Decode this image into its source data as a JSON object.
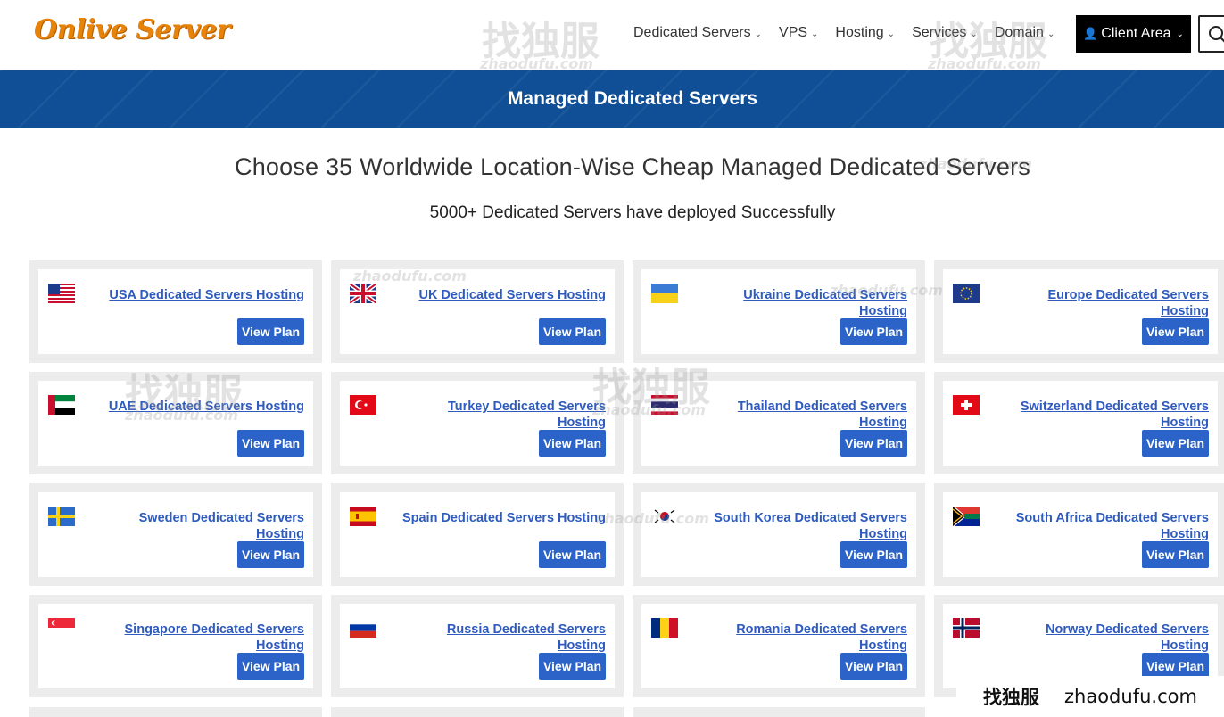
{
  "header": {
    "logo": "Onlive Server",
    "nav": [
      {
        "label": "Dedicated Servers"
      },
      {
        "label": "VPS"
      },
      {
        "label": "Hosting"
      },
      {
        "label": "Services"
      },
      {
        "label": "Domain"
      }
    ],
    "client_area": "Client Area"
  },
  "banner": {
    "title": "Managed Dedicated Servers"
  },
  "main": {
    "subtitle": "Choose 35 Worldwide Location-Wise Cheap Managed Dedicated Servers",
    "tagline": "5000+ Dedicated Servers have deployed Successfully",
    "cards": [
      {
        "title": "USA Dedicated Servers Hosting",
        "button": "View Plan",
        "flag": "usa-flag"
      },
      {
        "title": "UK Dedicated Servers Hosting",
        "button": "View Plan",
        "flag": "uk-flag"
      },
      {
        "title": "Ukraine Dedicated Servers Hosting",
        "button": "View Plan",
        "flag": "ukraine-flag"
      },
      {
        "title": "Europe Dedicated Servers Hosting",
        "button": "View Plan",
        "flag": "eu-flag"
      },
      {
        "title": "UAE Dedicated Servers Hosting",
        "button": "View Plan",
        "flag": "uae-flag"
      },
      {
        "title": "Turkey Dedicated Servers Hosting",
        "button": "View Plan",
        "flag": "turkey-flag"
      },
      {
        "title": "Thailand Dedicated Servers Hosting",
        "button": "View Plan",
        "flag": "thailand-flag"
      },
      {
        "title": "Switzerland Dedicated Servers Hosting",
        "button": "View Plan",
        "flag": "switzerland-flag"
      },
      {
        "title": "Sweden Dedicated Servers Hosting",
        "button": "View Plan",
        "flag": "sweden-flag"
      },
      {
        "title": "Spain Dedicated Servers Hosting",
        "button": "View Plan",
        "flag": "spain-flag"
      },
      {
        "title": "South Korea Dedicated Servers Hosting",
        "button": "View Plan",
        "flag": "south-korea-flag"
      },
      {
        "title": "South Africa Dedicated Servers Hosting",
        "button": "View Plan",
        "flag": "south-africa-flag"
      },
      {
        "title": "Singapore Dedicated Servers Hosting",
        "button": "View Plan",
        "flag": "singapore-flag"
      },
      {
        "title": "Russia Dedicated Servers Hosting",
        "button": "View Plan",
        "flag": "russia-flag"
      },
      {
        "title": "Romania Dedicated Servers Hosting",
        "button": "View Plan",
        "flag": "romania-flag"
      },
      {
        "title": "Norway Dedicated Servers Hosting",
        "button": "View Plan",
        "flag": "norway-flag"
      }
    ]
  },
  "watermark": {
    "cn": "找独服",
    "site": "zhaodufu.com"
  },
  "colors": {
    "banner": "#104f95",
    "button": "#2b63c9",
    "link": "#2e5bbd",
    "logo": "#e8830a"
  }
}
